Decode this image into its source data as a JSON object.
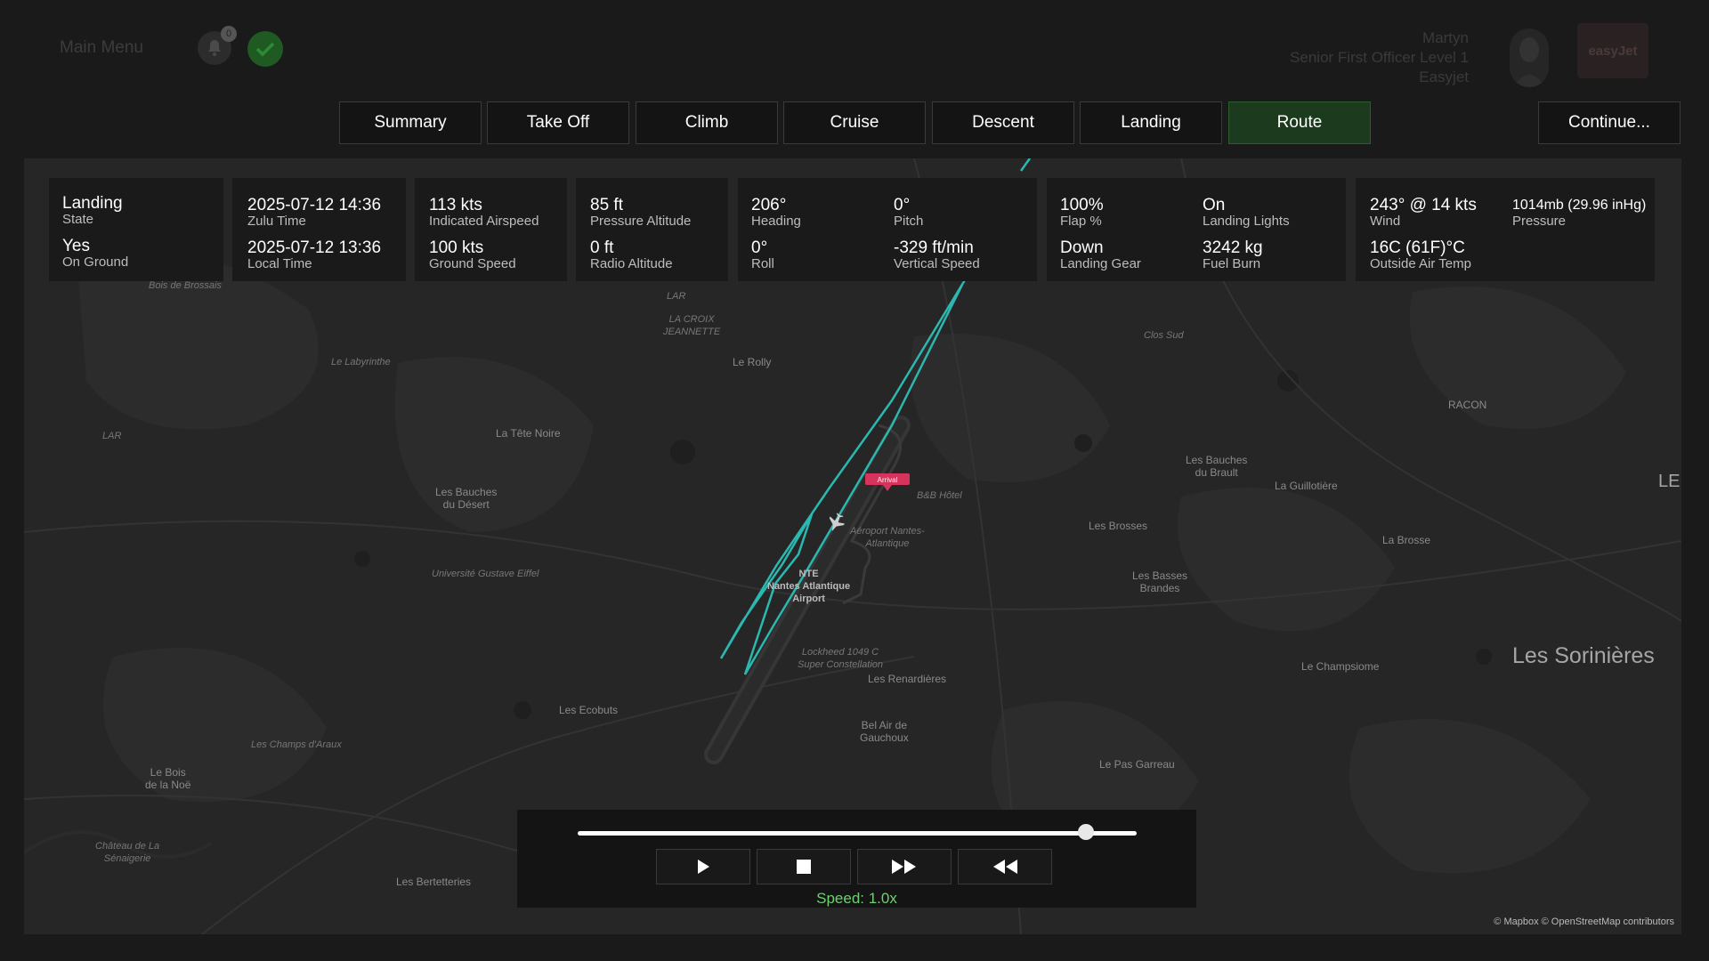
{
  "header": {
    "main_menu": "Main Menu",
    "notification_count": "0",
    "user": {
      "name": "Martyn",
      "rank": "Senior First Officer Level 1",
      "airline": "Easyjet"
    },
    "logo_text": "easyJet"
  },
  "tabs": [
    {
      "label": "Summary",
      "active": false
    },
    {
      "label": "Take Off",
      "active": false
    },
    {
      "label": "Climb",
      "active": false
    },
    {
      "label": "Cruise",
      "active": false
    },
    {
      "label": "Descent",
      "active": false
    },
    {
      "label": "Landing",
      "active": false
    },
    {
      "label": "Route",
      "active": true
    }
  ],
  "continue_label": "Continue...",
  "flight_info": {
    "state": {
      "value": "Landing",
      "label": "State"
    },
    "on_ground": {
      "value": "Yes",
      "label": "On Ground"
    },
    "zulu_time": {
      "value": "2025-07-12 14:36",
      "label": "Zulu Time"
    },
    "local_time": {
      "value": "2025-07-12 13:36",
      "label": "Local Time"
    },
    "indicated_airspeed": {
      "value": "113 kts",
      "label": "Indicated Airspeed"
    },
    "ground_speed": {
      "value": "100 kts",
      "label": "Ground Speed"
    },
    "pressure_altitude": {
      "value": "85 ft",
      "label": "Pressure Altitude"
    },
    "radio_altitude": {
      "value": "0 ft",
      "label": "Radio Altitude"
    },
    "heading": {
      "value": "206°",
      "label": "Heading"
    },
    "pitch": {
      "value": "0°",
      "label": "Pitch"
    },
    "roll": {
      "value": "0°",
      "label": "Roll"
    },
    "vertical_speed": {
      "value": "-329 ft/min",
      "label": "Vertical Speed"
    },
    "flap": {
      "value": "100%",
      "label": "Flap %"
    },
    "landing_lights": {
      "value": "On",
      "label": "Landing Lights"
    },
    "landing_gear": {
      "value": "Down",
      "label": "Landing Gear"
    },
    "fuel_burn": {
      "value": "3242 kg",
      "label": "Fuel Burn"
    },
    "wind": {
      "value": "243° @ 14 kts",
      "label": "Wind"
    },
    "pressure": {
      "value": "1014mb (29.96 inHg)",
      "label": "Pressure"
    },
    "outside_air_temp": {
      "value": "16C (61F)°C",
      "label": "Outside Air Temp"
    }
  },
  "map": {
    "marker_label": "Arrival",
    "labels": {
      "lar_top": "LAR",
      "la_croix": "LA CROIX\nJEANNETTE",
      "le_rolly": "Le Rolly",
      "clos_sud": "Clos Sud",
      "le_labyrinthe": "Le Labyrinthe",
      "bois_brossais": "Bois de Brossais",
      "lar_left": "LAR",
      "la_tete_noire": "La Tête Noire",
      "racon": "RACON",
      "les_bauches_brault": "Les Bauches\ndu Brault",
      "la_guillotiere": "La Guillotière",
      "le": "LE",
      "les_bauches_desert": "Les Bauches\ndu Désert",
      "bb_hotel": "B&B Hôtel",
      "aeroport": "Aéroport Nantes-\nAtlantique",
      "les_brosses": "Les Brosses",
      "la_brosse": "La Brosse",
      "universite": "Université Gustave Eiffel",
      "nte": "NTE\nNantes Atlantique\nAirport",
      "les_basses_brandes": "Les Basses\nBrandes",
      "lockheed": "Lockheed 1049 C\nSuper Constellation",
      "le_champsiome": "Le Champsiome",
      "les_sorinieres": "Les Sorinières",
      "les_renardieres": "Les Renardières",
      "les_ecobuts": "Les Ecobuts",
      "bel_air": "Bel Air de\nGauchoux",
      "les_champs": "Les Champs d'Araux",
      "le_bois_noe": "Le Bois\nde la Noë",
      "le_pas_garreau": "Le Pas Garreau",
      "chateau": "Château de La\nSénaigerie",
      "les_bertetteries": "Les Bertetteries"
    },
    "attribution": "© Mapbox © OpenStreetMap contributors"
  },
  "playback": {
    "progress_fraction": 0.91,
    "speed_text": "Speed: 1.0x",
    "speed_color": "#6fcf73"
  },
  "colors": {
    "route": "#2bb8b0",
    "active_tab": "#1c3a1e",
    "marker": "#d6335d"
  }
}
